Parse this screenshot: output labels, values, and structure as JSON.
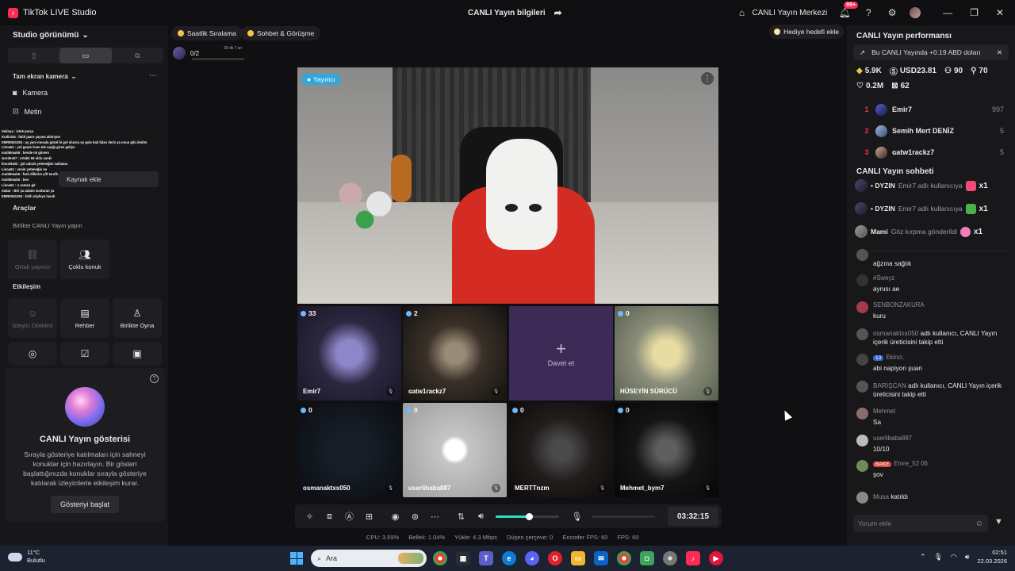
{
  "titlebar": {
    "app_name": "TikTok LIVE Studio",
    "center_title": "CANLI Yayın bilgileri",
    "center_right_label": "CANLI Yayın Merkezi",
    "notif_badge": "99+"
  },
  "sidebar": {
    "view_title": "Studio görünümü",
    "scene_title": "Tam ekran kamera",
    "items": [
      {
        "label": "Kamera",
        "icon": "camera-icon"
      },
      {
        "label": "Metin",
        "icon": "text-icon"
      }
    ],
    "add_source": "Kaynak ekle",
    "tools_header": "Araçlar",
    "live_together_header": "Birlikte CANLI Yayın yapın",
    "interaction_header": "Etkileşim",
    "tiles_row1": [
      {
        "label": "Ortak yayıncı",
        "icon": "link-icon",
        "enabled": false
      },
      {
        "label": "Çoklu konuk",
        "icon": "multi-guest-icon",
        "enabled": true
      }
    ],
    "tiles_row2": [
      {
        "label": "İzleyici Dilekleri",
        "icon": "viewer-wish-icon",
        "enabled": false
      },
      {
        "label": "Rehber",
        "icon": "guide-icon",
        "enabled": true
      },
      {
        "label": "Birlikte Oyna",
        "icon": "play-together-icon",
        "enabled": true
      }
    ],
    "chat_overlay": [
      "Selinya : istek parça",
      "Kralixt34 : fatih jaaro yayına aldırıyım",
      "EMRE551255 : ay yani mesala güzel bi gol olunca ey gole bak falan deriz ya onun gibi dedim",
      "Linoa51 : yol geçen hanı mk uşağı giren geliyo",
      "mutiMmak6 : bende mi gitsem",
      "wordex57 : ortalık 56 oldu sanki",
      "İmosel402 : gtt cabcık yeteneğini saklama",
      "Linoa51 : senin yeteneğin ne",
      "mutiMmak6 : fazlı dillerim çift taraflı",
      "mutiMmak6 : ben",
      "Linoa51 : o zaman git",
      "Sukar : Biri şu adamı susturan ya",
      "EMRE551255 : lohh söyleyn lavuk"
    ],
    "showcase": {
      "title": "CANLI Yayın gösterisi",
      "desc": "Sırayla gösteriye katılmaları için sahneyi konuklar için hazırlayın. Bir gösteri başlattığınızda konuklar sırayla gösteriye katılarak izleyicilerle etkileşim kurar.",
      "button": "Gösteriyi başlat"
    }
  },
  "center": {
    "pills": [
      "Saatlik Sıralama",
      "Sohbet & Görüşme"
    ],
    "gift_goal": "Hediye hedefi ekle",
    "match_score": "0/2",
    "match_time": "30 dk 7 sn",
    "host_badge": "Yayıncı",
    "guests": [
      {
        "name": "Emir7",
        "count": "33"
      },
      {
        "name": "ɢatw1rackz7",
        "count": "2"
      },
      {
        "name": "",
        "count": "",
        "invite": "Davet et"
      },
      {
        "name": "HÜSEYİN SÜRÜCÜ",
        "count": "0"
      },
      {
        "name": "osmanaktxs050",
        "count": "0"
      },
      {
        "name": "userlibaba887",
        "count": "0"
      },
      {
        "name": "MERTTnzm",
        "count": "0"
      },
      {
        "name": "Mehmet_bym7",
        "count": "0"
      }
    ],
    "volume_level": 0.52,
    "timer": "03:32:15",
    "stats": [
      "CPU: 3.59%",
      "Bellek: 1.04%",
      "Yükle: 4.3 Mbps",
      "Düşen çerçeve: 0",
      "Encoder FPS: 60",
      "FPS: 60"
    ]
  },
  "right": {
    "perf_title": "CANLI Yayın performansı",
    "perf_info": "Bu CANLI Yayında +0.19 ABD doları",
    "stats": {
      "diamonds": "5.9K",
      "usd": "USD23.81",
      "viewers": "90",
      "followers": "70",
      "likes": "0.2M",
      "gifters": "62"
    },
    "ranking": [
      {
        "n": "1",
        "name": "Emir7",
        "value": "997"
      },
      {
        "n": "2",
        "name": "Semih Mert DENİZ",
        "value": "5"
      },
      {
        "n": "3",
        "name": "ɢatw1rackz7",
        "value": "5"
      }
    ],
    "chat_title": "CANLI Yayın sohbeti",
    "gift_events": [
      {
        "user": "DYZIN",
        "text": "Emir7 adlı kullanıcıya",
        "qty": "x1"
      },
      {
        "user": "DYZIN",
        "text": "Emir7 adlı kullanıcıya",
        "qty": "x1"
      },
      {
        "user": "Mami",
        "text": "Göz kırpma gönderildi",
        "qty": "x1"
      }
    ],
    "messages": [
      {
        "user": "",
        "text": "ağzına sağlık"
      },
      {
        "user": "#Sweyz",
        "text": "aynısı ae"
      },
      {
        "user": "SENBONZAKURA",
        "text": "kuru"
      },
      {
        "user": "osmanaktxs050",
        "text": "adlı kullanıcı, CANLI Yayın içerik üreticisini takip etti",
        "system": true
      },
      {
        "user": "Ekinci.",
        "text": "abi napiyon şuan",
        "level": "13"
      },
      {
        "user": "BARIŞCAN",
        "text": "adlı kullanıcı, CANLI Yayın içerik üreticisini takip etti",
        "system": true
      },
      {
        "user": "Mehmet",
        "text": "Sa"
      },
      {
        "user": "userlibaba887",
        "text": "10/10"
      },
      {
        "user": "Emre_52 06",
        "text": "şov",
        "badge": "BAKE"
      },
      {
        "user": "Musa",
        "text": "katıldı",
        "joined": true
      }
    ],
    "comment_placeholder": "Yorum ekle"
  },
  "taskbar": {
    "temp": "11°C",
    "weather": "Bulutlu",
    "search": "Ara",
    "time": "02:51",
    "date": "22.03.2026"
  }
}
